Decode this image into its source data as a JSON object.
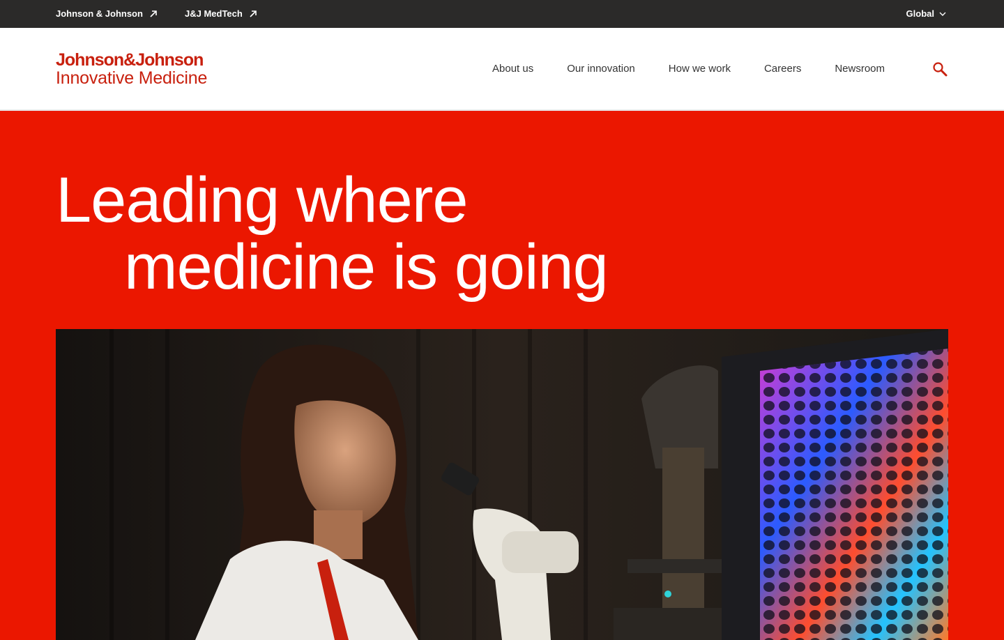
{
  "utility_bar": {
    "links": [
      {
        "label": "Johnson & Johnson"
      },
      {
        "label": "J&J MedTech"
      }
    ],
    "region": {
      "label": "Global"
    }
  },
  "header": {
    "logo": {
      "line1": "Johnson&Johnson",
      "line2": "Innovative Medicine"
    },
    "nav": [
      {
        "label": "About us"
      },
      {
        "label": "Our innovation"
      },
      {
        "label": "How we work"
      },
      {
        "label": "Careers"
      },
      {
        "label": "Newsroom"
      }
    ]
  },
  "hero": {
    "title_line1": "Leading where",
    "title_line2": "medicine is going"
  },
  "colors": {
    "brand_red": "#eb1700",
    "logo_red": "#c8200e",
    "utility_bg": "#2b2a29"
  }
}
